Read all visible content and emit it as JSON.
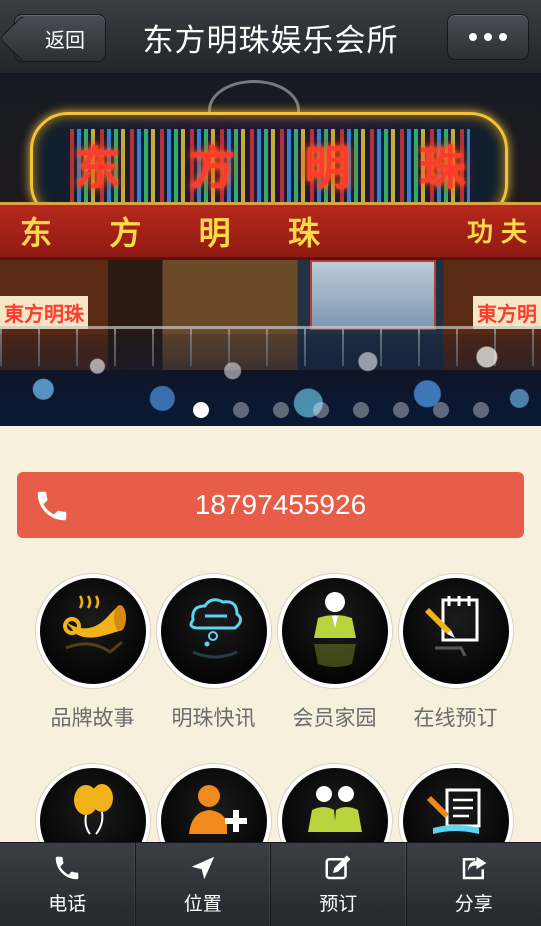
{
  "header": {
    "back_label": "返回",
    "title": "东方明珠娱乐会所"
  },
  "banner": {
    "neon_sign_chars": [
      "东",
      "方",
      "明",
      "珠"
    ],
    "facade_sign_chars": [
      "东",
      "方",
      "明",
      "珠"
    ],
    "facade_right_text": "功夫",
    "side_sign_left": "東方明珠",
    "side_sign_right": "東方明",
    "slide_count": 8,
    "active_slide": 1
  },
  "phone": {
    "number": "18797455926",
    "icon": "phone-icon",
    "color": "#e85d47"
  },
  "menu": {
    "items": [
      {
        "label": "品牌故事",
        "icon": "horn-icon",
        "color": "#f2b21a"
      },
      {
        "label": "明珠快讯",
        "icon": "speech-cloud-icon",
        "color": "#5fd4ef"
      },
      {
        "label": "会员家园",
        "icon": "member-icon",
        "color": "#b9d33c"
      },
      {
        "label": "在线预订",
        "icon": "booking-pen-icon",
        "color": "#ffffff"
      },
      {
        "label": "",
        "icon": "balloons-icon",
        "color": "#f2b21a"
      },
      {
        "label": "",
        "icon": "add-user-icon",
        "color": "#f08a1c"
      },
      {
        "label": "",
        "icon": "group-icon",
        "color": "#b9d33c"
      },
      {
        "label": "",
        "icon": "document-pen-icon",
        "color": "#5fd4ef"
      }
    ]
  },
  "tabbar": {
    "tabs": [
      {
        "label": "电话",
        "icon": "phone-icon"
      },
      {
        "label": "位置",
        "icon": "location-arrow-icon"
      },
      {
        "label": "预订",
        "icon": "edit-icon"
      },
      {
        "label": "分享",
        "icon": "share-icon"
      }
    ]
  }
}
